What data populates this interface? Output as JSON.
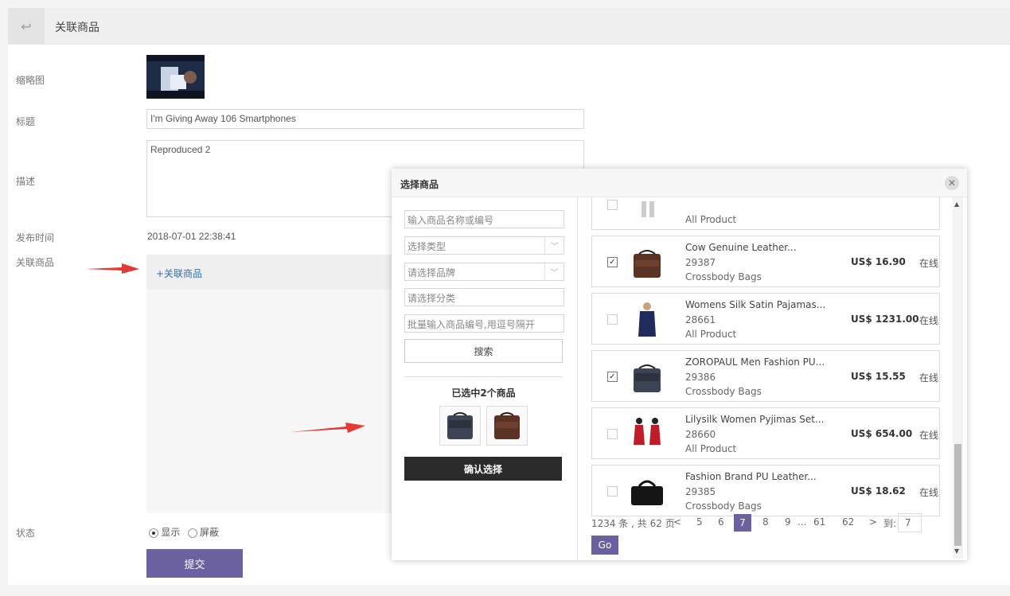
{
  "header": {
    "back_icon": "back-arrow-icon",
    "title": "关联商品"
  },
  "form": {
    "thumb_label": "缩略图",
    "title_label": "标题",
    "title_value": "I'm Giving Away 106 Smartphones",
    "desc_label": "描述",
    "desc_value": "Reproduced 2",
    "publish_label": "发布时间",
    "publish_value": "2018-07-01 22:38:41",
    "assoc_label": "关联商品",
    "assoc_link": "+关联商品",
    "status_label": "状态",
    "status_options": [
      {
        "label": "显示",
        "selected": true
      },
      {
        "label": "屏蔽",
        "selected": false
      }
    ],
    "submit_label": "提交"
  },
  "modal": {
    "title": "选择商品",
    "close_icon": "close-icon",
    "filters": {
      "keyword_placeholder": "输入商品名称或编号",
      "type_placeholder": "选择类型",
      "brand_placeholder": "请选择品牌",
      "category_placeholder": "请选择分类",
      "batch_placeholder": "批量输入商品编号,用逗号隔开",
      "search_label": "搜索"
    },
    "selected_title": "已选中2个商品",
    "confirm_label": "确认选择",
    "products": [
      {
        "name": "",
        "no": "",
        "category": "All Product",
        "price": "",
        "status": "",
        "checked": false
      },
      {
        "name": "Cow Genuine Leather...",
        "no": "29387",
        "category": "Crossbody Bags",
        "price": "US$ 16.90",
        "status": "在线",
        "checked": true
      },
      {
        "name": "Womens Silk Satin Pajamas...",
        "no": "28661",
        "category": "All Product",
        "price": "US$ 1231.00",
        "status": "在线",
        "checked": false
      },
      {
        "name": "ZOROPAUL Men Fashion PU...",
        "no": "29386",
        "category": "Crossbody Bags",
        "price": "US$ 15.55",
        "status": "在线",
        "checked": true
      },
      {
        "name": "Lilysilk Women Pyjimas Set...",
        "no": "28660",
        "category": "All Product",
        "price": "US$ 654.00",
        "status": "在线",
        "checked": false
      },
      {
        "name": "Fashion Brand PU Leather...",
        "no": "29385",
        "category": "Crossbody Bags",
        "price": "US$ 18.62",
        "status": "在线",
        "checked": false
      }
    ],
    "pagination": {
      "summary": "1234 条 , 共 62 页",
      "prev": "<",
      "pages": [
        "5",
        "6",
        "7",
        "8",
        "9",
        "...",
        "61",
        "62"
      ],
      "current": "7",
      "next": ">",
      "goto_label": "到:",
      "goto_value": "7",
      "go_label": "Go"
    }
  },
  "colors": {
    "accent": "#6b61a0",
    "link": "#2d6fa8",
    "confirm": "#2b2b2b",
    "arrow": "#e53935"
  }
}
